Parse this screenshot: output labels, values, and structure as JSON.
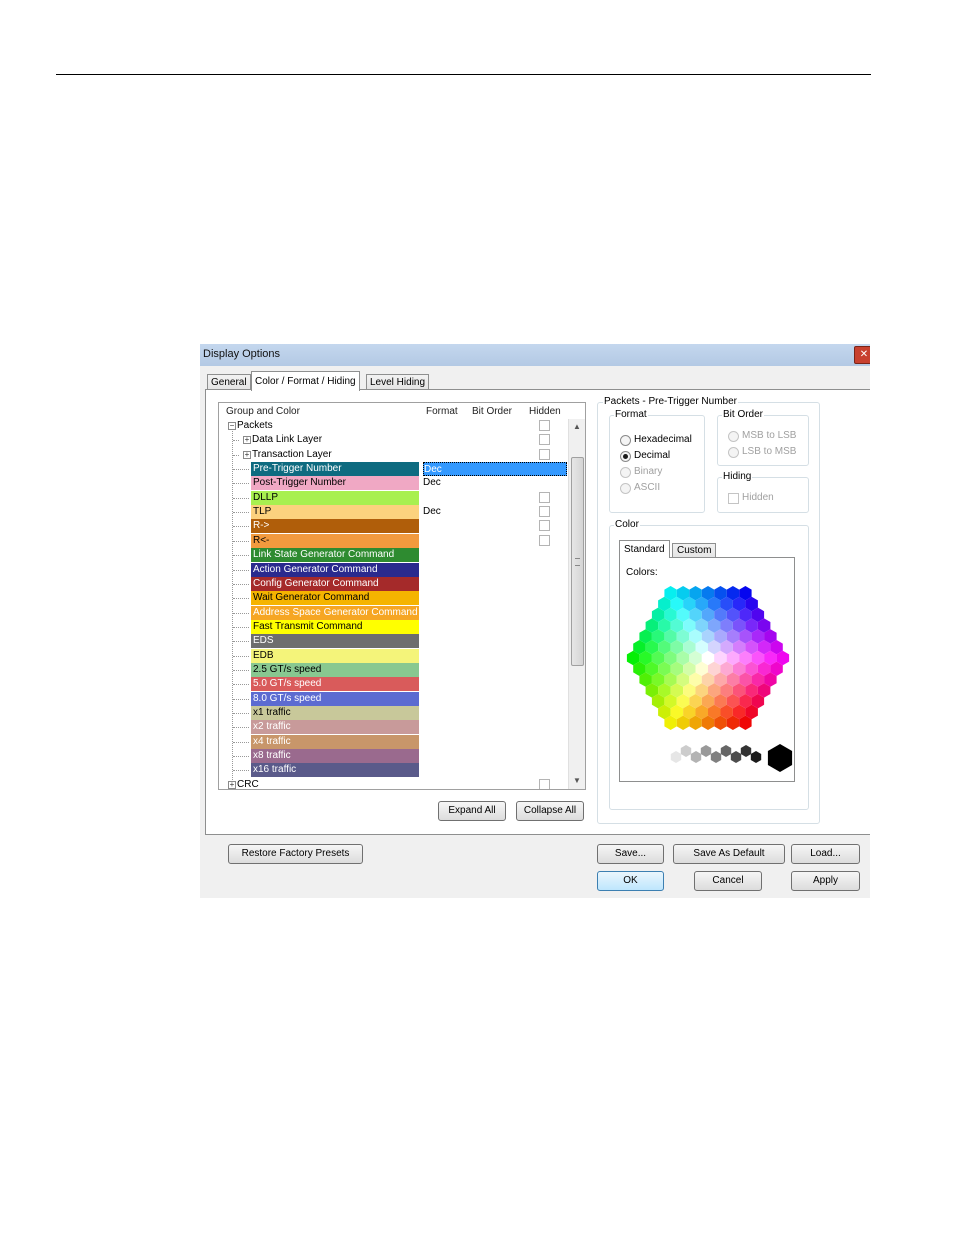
{
  "dialog": {
    "title": "Display Options",
    "close_glyph": "✕"
  },
  "tabs": [
    "General",
    "Color / Format / Hiding",
    "Level Hiding"
  ],
  "tree": {
    "columns": {
      "group": "Group and Color",
      "format": "Format",
      "bit_order": "Bit Order",
      "hidden": "Hidden"
    },
    "rows": [
      {
        "label": "Packets",
        "level": 0,
        "expander": "−",
        "color": null,
        "format": "",
        "hidden_box": true
      },
      {
        "label": "Data Link Layer",
        "level": 1,
        "expander": "+",
        "color": null,
        "format": "",
        "hidden_box": true
      },
      {
        "label": "Transaction Layer",
        "level": 1,
        "expander": "+",
        "color": null,
        "format": "",
        "hidden_box": true
      },
      {
        "label": "Pre-Trigger Number",
        "level": 1,
        "color": "#0e6b80",
        "text_color": "#ffffff",
        "format": "Dec",
        "selected": true,
        "hidden_box": false
      },
      {
        "label": "Post-Trigger Number",
        "level": 1,
        "color": "#f0a8c4",
        "text_color": "#000000",
        "format": "Dec",
        "hidden_box": false
      },
      {
        "label": "DLLP",
        "level": 1,
        "color": "#a8f050",
        "text_color": "#000000",
        "format": "",
        "hidden_box": true
      },
      {
        "label": "TLP",
        "level": 1,
        "color": "#fcd27e",
        "text_color": "#000000",
        "format": "Dec",
        "hidden_box": true
      },
      {
        "label": "R->",
        "level": 1,
        "color": "#b05e0a",
        "text_color": "#ffffff",
        "format": "",
        "hidden_box": true
      },
      {
        "label": "R<-",
        "level": 1,
        "color": "#f29a3e",
        "text_color": "#000000",
        "format": "",
        "hidden_box": true
      },
      {
        "label": "Link State Generator Command",
        "level": 1,
        "color": "#2e8b30",
        "text_color": "#ffffff",
        "format": "",
        "hidden_box": false
      },
      {
        "label": "Action Generator Command",
        "level": 1,
        "color": "#2a2a8e",
        "text_color": "#ffffff",
        "format": "",
        "hidden_box": false
      },
      {
        "label": "Config Generator Command",
        "level": 1,
        "color": "#a52a2a",
        "text_color": "#ffffff",
        "format": "",
        "hidden_box": false
      },
      {
        "label": "Wait Generator Command",
        "level": 1,
        "color": "#f5b400",
        "text_color": "#000000",
        "format": "",
        "hidden_box": false
      },
      {
        "label": "Address Space Generator Command",
        "level": 1,
        "color": "#f6a623",
        "text_color": "#ffffff",
        "format": "",
        "hidden_box": false
      },
      {
        "label": "Fast Transmit Command",
        "level": 1,
        "color": "#ffff00",
        "text_color": "#000000",
        "format": "",
        "hidden_box": false
      },
      {
        "label": "EDS",
        "level": 1,
        "color": "#6e6e6e",
        "text_color": "#ffffff",
        "format": "",
        "hidden_box": false
      },
      {
        "label": "EDB",
        "level": 1,
        "color": "#f4f47a",
        "text_color": "#000000",
        "format": "",
        "hidden_box": false
      },
      {
        "label": "2.5 GT/s speed",
        "level": 1,
        "color": "#88c890",
        "text_color": "#000000",
        "format": "",
        "hidden_box": false
      },
      {
        "label": "5.0 GT/s speed",
        "level": 1,
        "color": "#d95b5b",
        "text_color": "#ffffff",
        "format": "",
        "hidden_box": false
      },
      {
        "label": "8.0 GT/s speed",
        "level": 1,
        "color": "#5c6bd1",
        "text_color": "#ffffff",
        "format": "",
        "hidden_box": false
      },
      {
        "label": "x1 traffic",
        "level": 1,
        "color": "#c8c89a",
        "text_color": "#000000",
        "format": "",
        "hidden_box": false
      },
      {
        "label": "x2 traffic",
        "level": 1,
        "color": "#c89a9a",
        "text_color": "#ffffff",
        "format": "",
        "hidden_box": false
      },
      {
        "label": "x4 traffic",
        "level": 1,
        "color": "#c8966a",
        "text_color": "#ffffff",
        "format": "",
        "hidden_box": false
      },
      {
        "label": "x8 traffic",
        "level": 1,
        "color": "#9a6a8e",
        "text_color": "#ffffff",
        "format": "",
        "hidden_box": false
      },
      {
        "label": "x16 traffic",
        "level": 1,
        "color": "#5a5a8a",
        "text_color": "#ffffff",
        "format": "",
        "hidden_box": false
      },
      {
        "label": "CRC",
        "level": 0,
        "expander": "+",
        "color": null,
        "format": "",
        "hidden_box": true
      }
    ]
  },
  "tree_buttons": {
    "expand": "Expand All",
    "collapse": "Collapse All"
  },
  "details": {
    "group_title": "Packets - Pre-Trigger Number",
    "format": {
      "legend": "Format",
      "options": [
        {
          "label": "Hexadecimal",
          "checked": false,
          "enabled": true
        },
        {
          "label": "Decimal",
          "checked": true,
          "enabled": true
        },
        {
          "label": "Binary",
          "checked": false,
          "enabled": false
        },
        {
          "label": "ASCII",
          "checked": false,
          "enabled": false
        }
      ]
    },
    "bit_order": {
      "legend": "Bit Order",
      "options": [
        {
          "label": "MSB to LSB",
          "checked": false,
          "enabled": false
        },
        {
          "label": "LSB to MSB",
          "checked": false,
          "enabled": false
        }
      ]
    },
    "hiding": {
      "legend": "Hiding",
      "checkbox": "Hidden",
      "checked": false,
      "enabled": false
    },
    "color": {
      "legend": "Color",
      "tabs": [
        "Standard",
        "Custom"
      ],
      "colors_label": "Colors:"
    }
  },
  "footer": {
    "restore": "Restore Factory Presets",
    "save": "Save...",
    "save_default": "Save As Default",
    "load": "Load...",
    "ok": "OK",
    "cancel": "Cancel",
    "apply": "Apply"
  }
}
